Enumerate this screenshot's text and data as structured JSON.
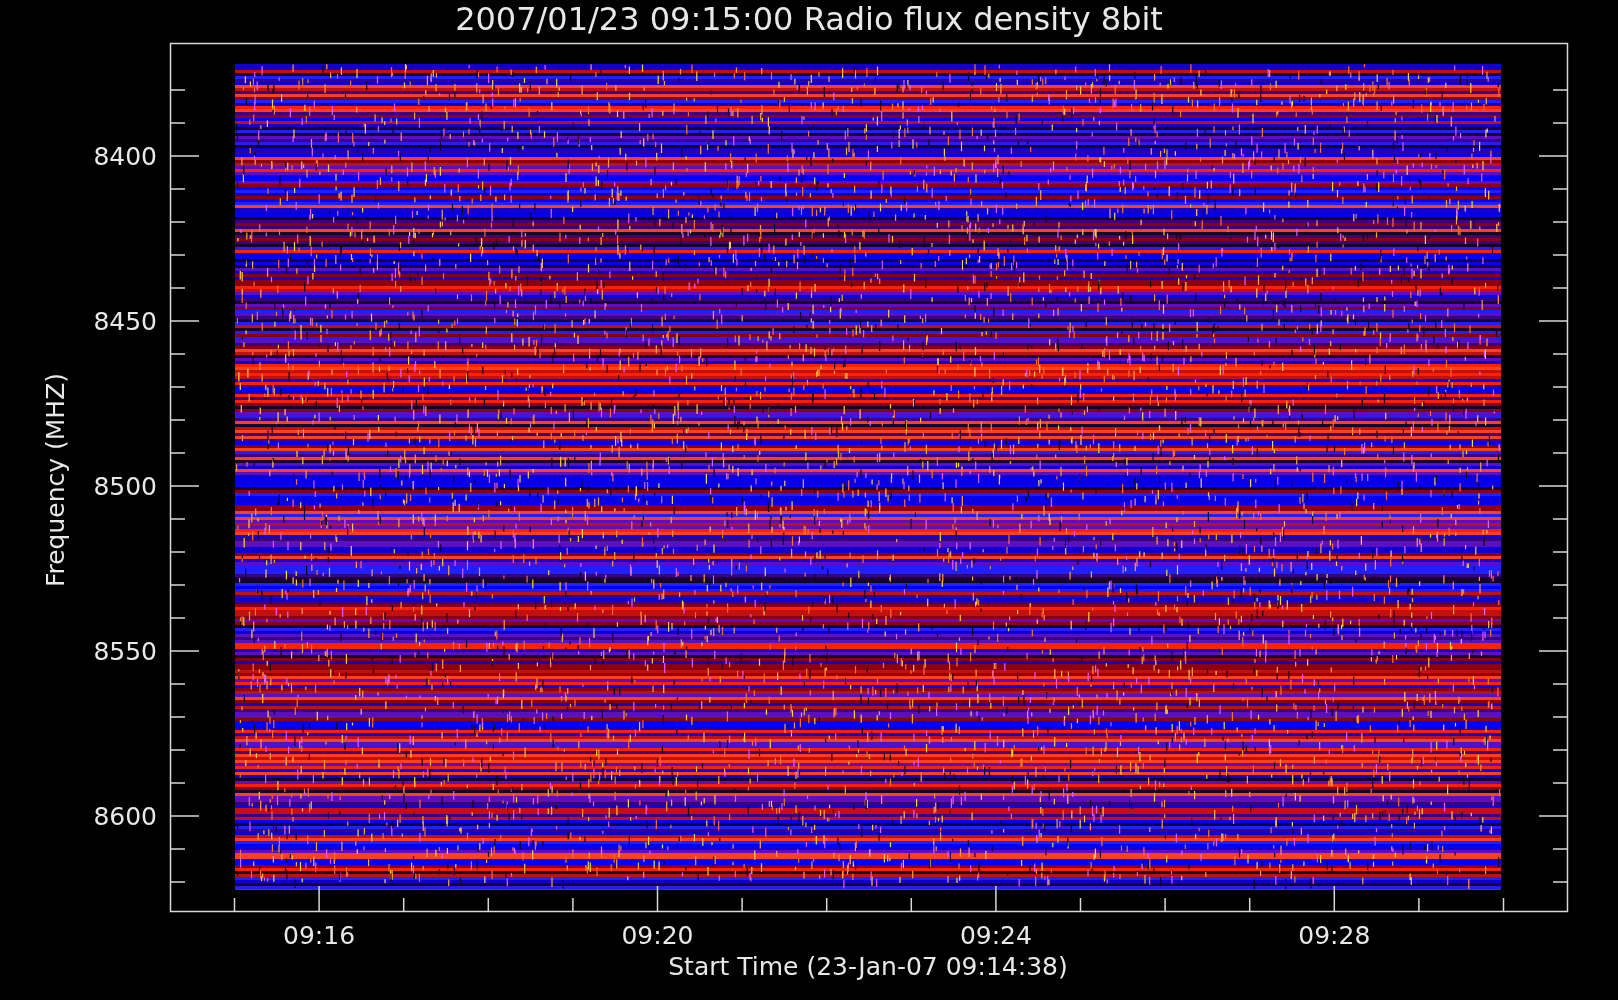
{
  "title": "2007/01/23 09:15:00 Radio flux density 8bit",
  "y_axis": {
    "label": "Frequency (MHZ)",
    "ticks": [
      "8400",
      "8450",
      "8500",
      "8550",
      "8600"
    ]
  },
  "x_axis": {
    "label": "Start Time (23-Jan-07 09:14:38)",
    "ticks": [
      "09:16",
      "09:20",
      "09:24",
      "09:28"
    ]
  }
}
